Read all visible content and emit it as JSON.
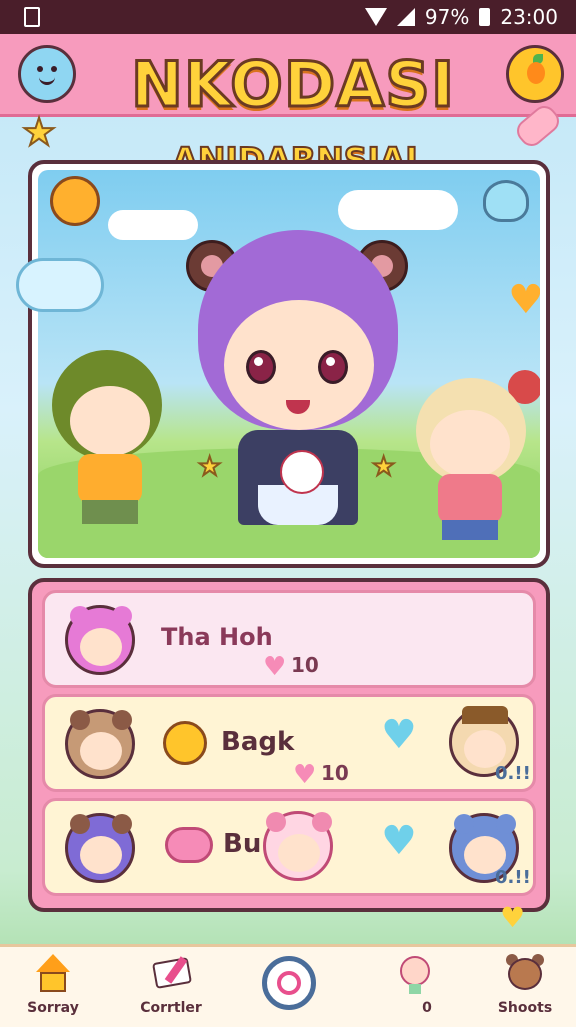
{
  "status_bar": {
    "battery_text": "97%",
    "time": "23:00"
  },
  "header": {
    "title": "NKODASI",
    "subtitle": "ANIDARNSIAI"
  },
  "friends": [
    {
      "name": "Tha Hoh",
      "badge": "10",
      "avatar_color": "#e67ad6"
    },
    {
      "name": "Bagk",
      "badge": "10",
      "extra": "0.!!",
      "avatar_color": "#c69a76"
    },
    {
      "name": "Bu",
      "extra": "0.!!",
      "avatar_color": "#7f6bd6"
    }
  ],
  "nav": {
    "items": [
      {
        "label": "Sorray",
        "icon": "home-icon"
      },
      {
        "label": "Corrtler",
        "icon": "pencil-icon"
      },
      {
        "label": "",
        "icon": "target-icon"
      },
      {
        "label": "0",
        "icon": "character-icon"
      },
      {
        "label": "Shoots",
        "icon": "bear-icon"
      }
    ]
  },
  "colors": {
    "accent_pink": "#f79bbd",
    "outline": "#5a2f3c",
    "title_yellow": "#ffd23b",
    "heart_blue": "#6fd0ea",
    "heart_pink": "#f68bb7"
  }
}
